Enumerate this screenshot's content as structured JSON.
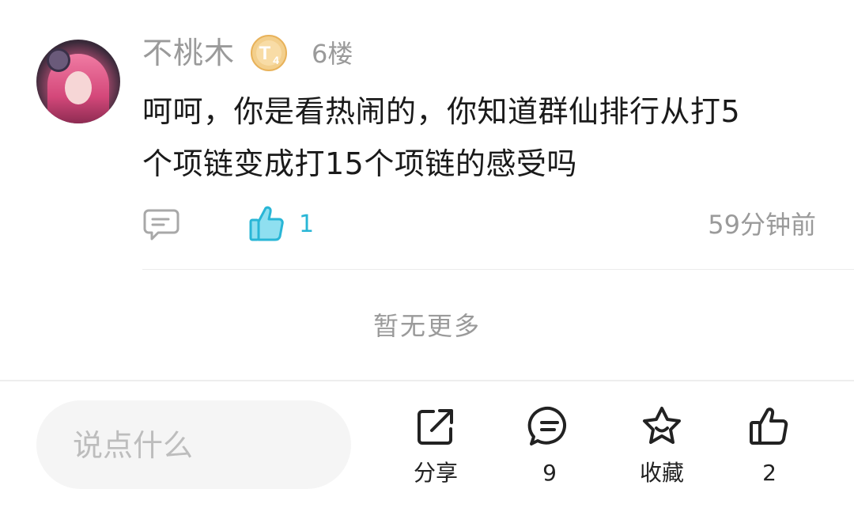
{
  "comment": {
    "username": "不桃木",
    "level_badge_letter": "T",
    "level_badge_number": "4",
    "floor": "6楼",
    "text_line1": "呵呵，你是看热闹的，你知道群仙排行从打5",
    "text_line2": "个项链变成打15个项链的感受吗",
    "like_count": "1",
    "timestamp": "59分钟前"
  },
  "list_footer": {
    "no_more": "暂无更多"
  },
  "bottom_bar": {
    "input_placeholder": "说点什么",
    "share_label": "分享",
    "comment_count": "9",
    "favorite_label": "收藏",
    "like_count": "2"
  },
  "icons": {
    "reply": "comment-bubble-icon",
    "like": "thumbs-up-icon",
    "share": "share-icon",
    "comments": "chat-bubble-icon",
    "favorite": "star-icon"
  },
  "colors": {
    "accent_like": "#29b6d6",
    "meta_text": "#9a9a9a",
    "badge_gold": "#e8b25a"
  }
}
